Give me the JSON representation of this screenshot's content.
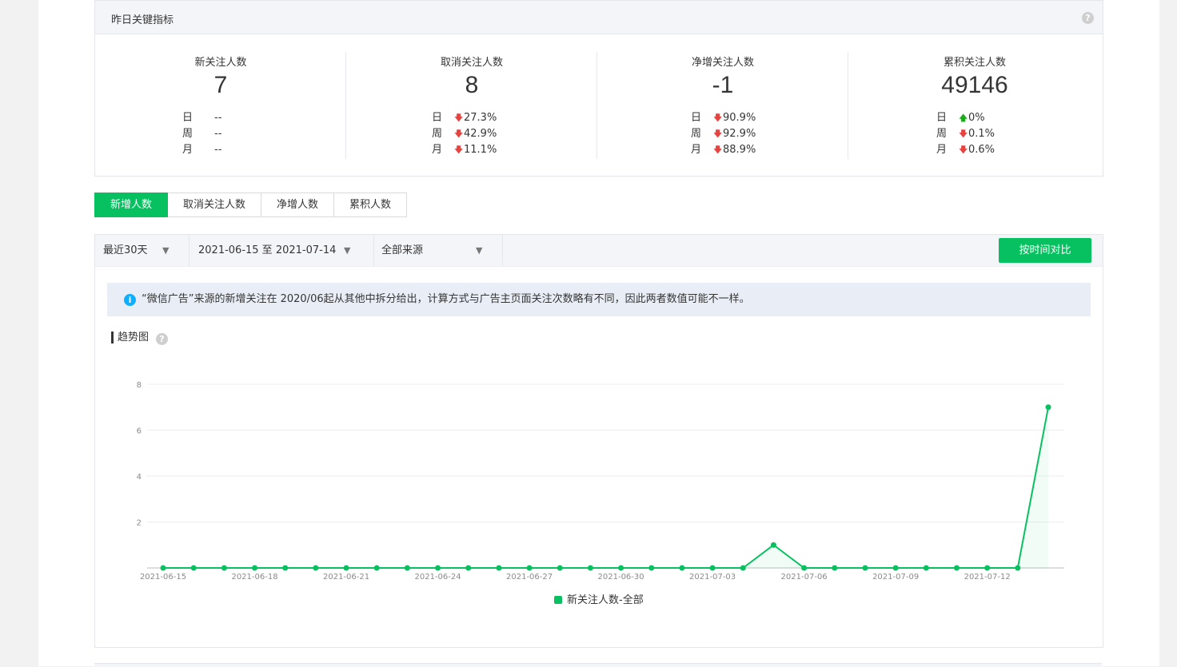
{
  "kpi": {
    "title": "昨日关键指标",
    "help": "?",
    "items": [
      {
        "label": "新关注人数",
        "value": "7",
        "rows": [
          {
            "period": "日",
            "arrow": "",
            "change": "--"
          },
          {
            "period": "周",
            "arrow": "",
            "change": "--"
          },
          {
            "period": "月",
            "arrow": "",
            "change": "--"
          }
        ]
      },
      {
        "label": "取消关注人数",
        "value": "8",
        "rows": [
          {
            "period": "日",
            "arrow": "down",
            "change": "27.3%"
          },
          {
            "period": "周",
            "arrow": "down",
            "change": "42.9%"
          },
          {
            "period": "月",
            "arrow": "down",
            "change": "11.1%"
          }
        ]
      },
      {
        "label": "净增关注人数",
        "value": "-1",
        "rows": [
          {
            "period": "日",
            "arrow": "down",
            "change": "90.9%"
          },
          {
            "period": "周",
            "arrow": "down",
            "change": "92.9%"
          },
          {
            "period": "月",
            "arrow": "down",
            "change": "88.9%"
          }
        ]
      },
      {
        "label": "累积关注人数",
        "value": "49146",
        "rows": [
          {
            "period": "日",
            "arrow": "up",
            "change": "0%"
          },
          {
            "period": "周",
            "arrow": "down",
            "change": "0.1%"
          },
          {
            "period": "月",
            "arrow": "down",
            "change": "0.6%"
          }
        ]
      }
    ]
  },
  "tabs": [
    {
      "label": "新增人数",
      "active": true
    },
    {
      "label": "取消关注人数",
      "active": false
    },
    {
      "label": "净增人数",
      "active": false
    },
    {
      "label": "累积人数",
      "active": false
    }
  ],
  "filters": {
    "range": "最近30天",
    "dates": "2021-06-15 至 2021-07-14",
    "source": "全部来源",
    "compare_label": "按时间对比"
  },
  "notice": {
    "icon": "i",
    "text": "“微信广告”来源的新增关注在 2020/06起从其他中拆分给出，计算方式与广告主页面关注次数略有不同，因此两者数值可能不一样。"
  },
  "trend": {
    "title": "趋势图",
    "help": "?"
  },
  "colors": {
    "accent": "#07c160",
    "down": "#e64340",
    "up": "#1aad19",
    "info": "#10aeff"
  },
  "chart_data": {
    "type": "line",
    "ylim": [
      0,
      8
    ],
    "y_ticks": [
      2,
      4,
      6,
      8
    ],
    "x": [
      "2021-06-15",
      "2021-06-16",
      "2021-06-17",
      "2021-06-18",
      "2021-06-19",
      "2021-06-20",
      "2021-06-21",
      "2021-06-22",
      "2021-06-23",
      "2021-06-24",
      "2021-06-25",
      "2021-06-26",
      "2021-06-27",
      "2021-06-28",
      "2021-06-29",
      "2021-06-30",
      "2021-07-01",
      "2021-07-02",
      "2021-07-03",
      "2021-07-04",
      "2021-07-05",
      "2021-07-06",
      "2021-07-07",
      "2021-07-08",
      "2021-07-09",
      "2021-07-10",
      "2021-07-11",
      "2021-07-12",
      "2021-07-13",
      "2021-07-14"
    ],
    "x_tick_labels": [
      "2021-06-15",
      "2021-06-18",
      "2021-06-21",
      "2021-06-24",
      "2021-06-27",
      "2021-06-30",
      "2021-07-03",
      "2021-07-06",
      "2021-07-09",
      "2021-07-12"
    ],
    "series": [
      {
        "name": "新关注人数-全部",
        "color": "#07c160",
        "values": [
          0,
          0,
          0,
          0,
          0,
          0,
          0,
          0,
          0,
          0,
          0,
          0,
          0,
          0,
          0,
          0,
          0,
          0,
          0,
          0,
          1,
          0,
          0,
          0,
          0,
          0,
          0,
          0,
          0,
          7
        ]
      }
    ],
    "legend_position": "bottom"
  }
}
